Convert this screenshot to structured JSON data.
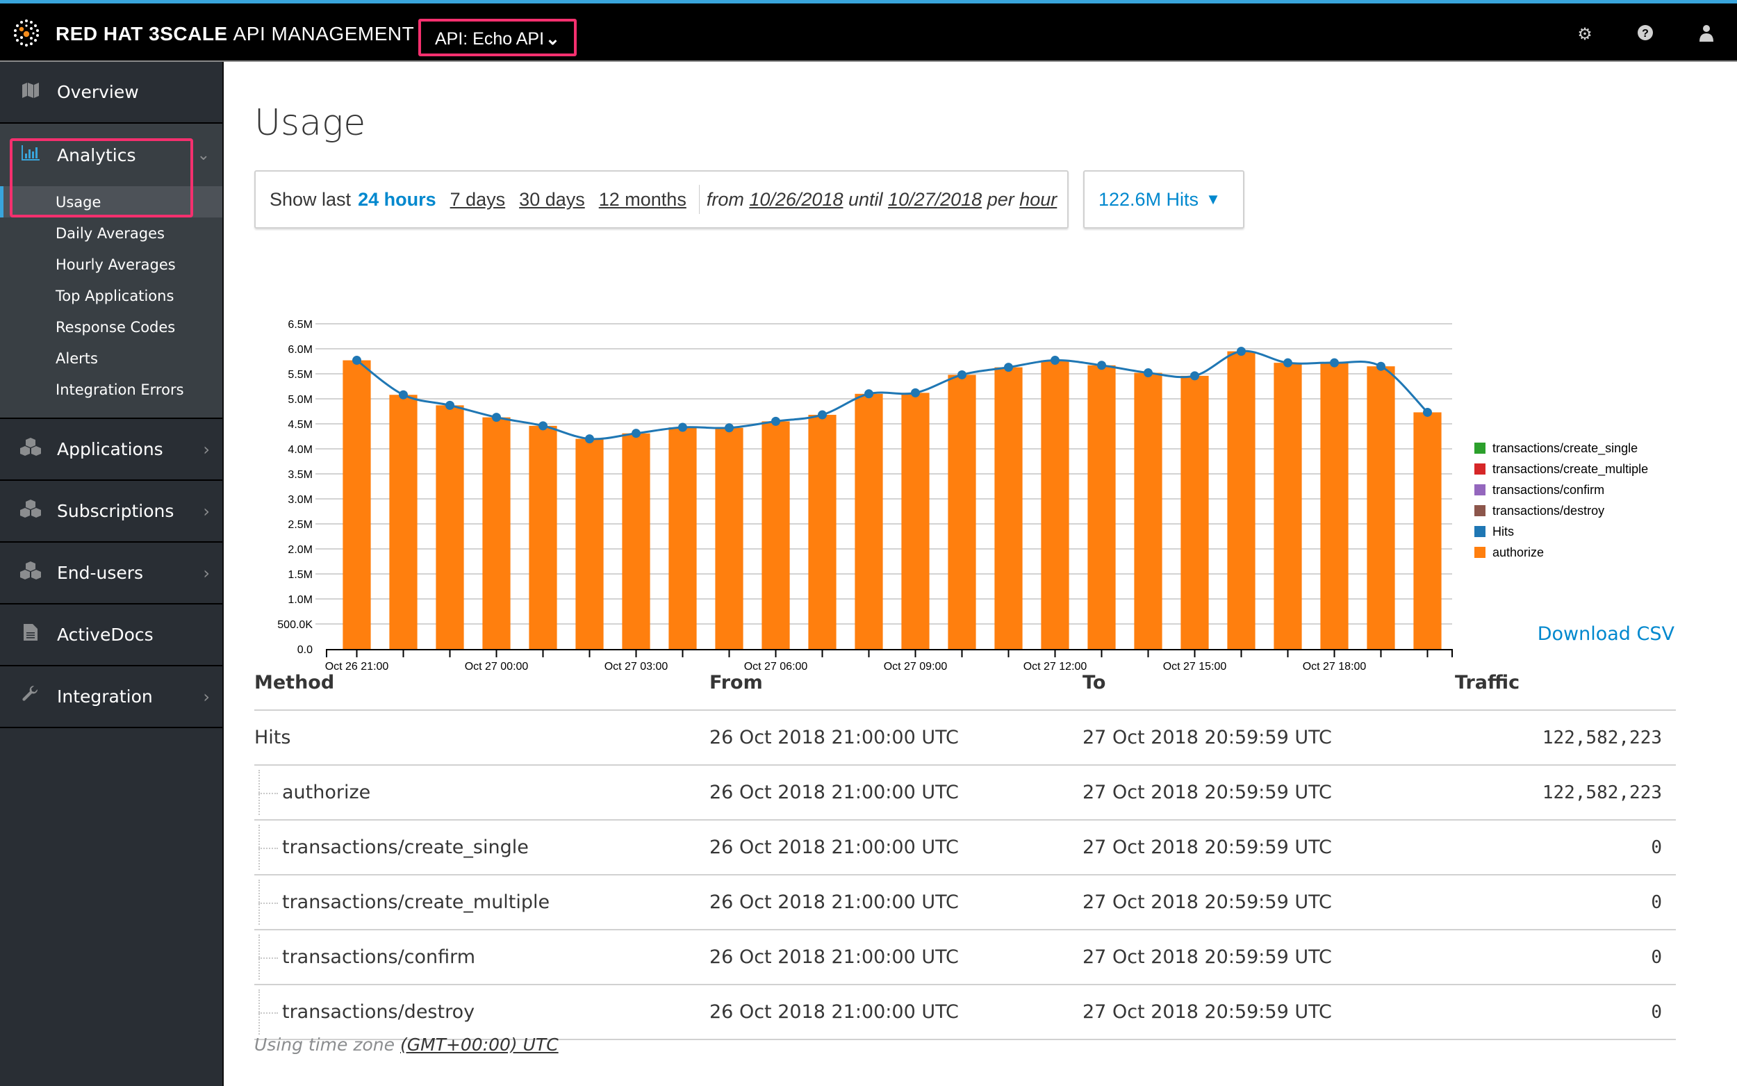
{
  "header": {
    "brand_bold": "RED HAT 3SCALE",
    "brand_light": "API MANAGEMENT",
    "api_selector": "API: Echo API",
    "icons": [
      "gear-icon",
      "help-icon",
      "user-icon"
    ]
  },
  "sidebar": {
    "overview": "Overview",
    "analytics": {
      "label": "Analytics",
      "items": [
        "Usage",
        "Daily Averages",
        "Hourly Averages",
        "Top Applications",
        "Response Codes",
        "Alerts",
        "Integration Errors"
      ],
      "active": "Usage"
    },
    "sections": [
      {
        "label": "Applications",
        "icon": "cubes-icon"
      },
      {
        "label": "Subscriptions",
        "icon": "cubes-icon"
      },
      {
        "label": "End-users",
        "icon": "cubes-icon"
      },
      {
        "label": "ActiveDocs",
        "icon": "document-icon"
      },
      {
        "label": "Integration",
        "icon": "wrench-icon"
      }
    ]
  },
  "main": {
    "title": "Usage",
    "period": {
      "show_last": "Show last",
      "current": "24 hours",
      "options": [
        "7 days",
        "30 days",
        "12 months"
      ],
      "from_label": "from",
      "from_date": "10/26/2018",
      "until_label": "until",
      "until_date": "10/27/2018",
      "per_label": "per",
      "granularity": "hour"
    },
    "metric_selector": "122.6M Hits",
    "download_csv": "Download CSV",
    "table": {
      "headers": [
        "Method",
        "From",
        "To",
        "Traffic"
      ],
      "rows": [
        {
          "method": "Hits",
          "from": "26 Oct 2018 21:00:00 UTC",
          "to": "27 Oct 2018 20:59:59 UTC",
          "traffic": "122,582,223",
          "child": false
        },
        {
          "method": "authorize",
          "from": "26 Oct 2018 21:00:00 UTC",
          "to": "27 Oct 2018 20:59:59 UTC",
          "traffic": "122,582,223",
          "child": true
        },
        {
          "method": "transactions/create_single",
          "from": "26 Oct 2018 21:00:00 UTC",
          "to": "27 Oct 2018 20:59:59 UTC",
          "traffic": "0",
          "child": true
        },
        {
          "method": "transactions/create_multiple",
          "from": "26 Oct 2018 21:00:00 UTC",
          "to": "27 Oct 2018 20:59:59 UTC",
          "traffic": "0",
          "child": true
        },
        {
          "method": "transactions/confirm",
          "from": "26 Oct 2018 21:00:00 UTC",
          "to": "27 Oct 2018 20:59:59 UTC",
          "traffic": "0",
          "child": true
        },
        {
          "method": "transactions/destroy",
          "from": "26 Oct 2018 21:00:00 UTC",
          "to": "27 Oct 2018 20:59:59 UTC",
          "traffic": "0",
          "child": true
        }
      ]
    },
    "timezone_label": "Using time zone",
    "timezone_value": "(GMT+00:00) UTC"
  },
  "chart_data": {
    "type": "bar",
    "title": "",
    "xlabel": "",
    "ylabel": "",
    "ylim": [
      0,
      6500000
    ],
    "yticks": [
      0,
      500000,
      1000000,
      1500000,
      2000000,
      2500000,
      3000000,
      3500000,
      4000000,
      4500000,
      5000000,
      5500000,
      6000000,
      6500000
    ],
    "ytick_labels": [
      "0.0",
      "500.0K",
      "1.0M",
      "1.5M",
      "2.0M",
      "2.5M",
      "3.0M",
      "3.5M",
      "4.0M",
      "4.5M",
      "5.0M",
      "5.5M",
      "6.0M",
      "6.5M"
    ],
    "categories": [
      "Oct 26 21:00",
      "Oct 26 22:00",
      "Oct 26 23:00",
      "Oct 27 00:00",
      "Oct 27 01:00",
      "Oct 27 02:00",
      "Oct 27 03:00",
      "Oct 27 04:00",
      "Oct 27 05:00",
      "Oct 27 06:00",
      "Oct 27 07:00",
      "Oct 27 08:00",
      "Oct 27 09:00",
      "Oct 27 10:00",
      "Oct 27 11:00",
      "Oct 27 12:00",
      "Oct 27 13:00",
      "Oct 27 14:00",
      "Oct 27 15:00",
      "Oct 27 16:00",
      "Oct 27 17:00",
      "Oct 27 18:00",
      "Oct 27 19:00",
      "Oct 27 20:00"
    ],
    "xtick_labels": [
      "Oct 26 21:00",
      "Oct 27 00:00",
      "Oct 27 03:00",
      "Oct 27 06:00",
      "Oct 27 09:00",
      "Oct 27 12:00",
      "Oct 27 15:00",
      "Oct 27 18:00"
    ],
    "series": [
      {
        "name": "authorize",
        "kind": "bar",
        "color": "#ff7f0e",
        "values": [
          5770000,
          5080000,
          4870000,
          4630000,
          4460000,
          4200000,
          4310000,
          4430000,
          4420000,
          4550000,
          4680000,
          5100000,
          5120000,
          5480000,
          5630000,
          5770000,
          5670000,
          5520000,
          5460000,
          5950000,
          5720000,
          5720000,
          5650000,
          4730000
        ]
      },
      {
        "name": "Hits",
        "kind": "line",
        "color": "#1f77b4",
        "values": [
          5770000,
          5080000,
          4870000,
          4630000,
          4460000,
          4200000,
          4310000,
          4430000,
          4420000,
          4550000,
          4680000,
          5100000,
          5120000,
          5480000,
          5630000,
          5770000,
          5670000,
          5520000,
          5460000,
          5950000,
          5720000,
          5720000,
          5650000,
          4730000
        ]
      }
    ],
    "legend": [
      {
        "name": "transactions/create_single",
        "color": "#2ca02c"
      },
      {
        "name": "transactions/create_multiple",
        "color": "#d62728"
      },
      {
        "name": "transactions/confirm",
        "color": "#9467bd"
      },
      {
        "name": "transactions/destroy",
        "color": "#8c564b"
      },
      {
        "name": "Hits",
        "color": "#1f77b4"
      },
      {
        "name": "authorize",
        "color": "#ff7f0e"
      }
    ],
    "legend_position": "right",
    "grid": true
  }
}
